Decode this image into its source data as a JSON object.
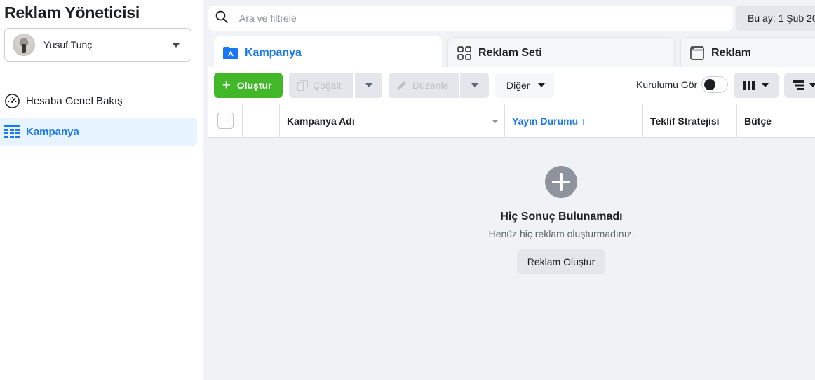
{
  "app": {
    "title": "Reklam Yöneticisi"
  },
  "account": {
    "name": "Yusuf Tunç"
  },
  "sidebar": {
    "items": [
      {
        "label": "Hesaba Genel Bakış",
        "icon": "gauge-icon"
      },
      {
        "label": "Kampanya",
        "icon": "table-grid-icon",
        "active": true
      }
    ]
  },
  "search": {
    "placeholder": "Ara ve filtrele"
  },
  "date_range": {
    "label": "Bu ay: 1 Şub 20"
  },
  "tabs": [
    {
      "label": "Kampanya",
      "icon": "folder-icon",
      "active": true
    },
    {
      "label": "Reklam Seti",
      "icon": "grid-squares-icon"
    },
    {
      "label": "Reklam",
      "icon": "ad-window-icon"
    }
  ],
  "toolbar": {
    "create_label": "Oluştur",
    "duplicate_label": "Çoğalt",
    "edit_label": "Düzenle",
    "more_label": "Diğer",
    "setup_label": "Kurulumu Gör"
  },
  "table": {
    "columns": [
      "Kampanya Adı",
      "Yayın Durumu ↑",
      "Teklif Stratejisi",
      "Bütçe"
    ]
  },
  "empty_state": {
    "title": "Hiç Sonuç Bulunamadı",
    "subtitle": "Henüz hiç reklam oluşturmadınız.",
    "button_label": "Reklam Oluştur"
  },
  "colors": {
    "accent": "#1877f2",
    "create_green": "#42b72a",
    "background": "#f0f2f5"
  }
}
